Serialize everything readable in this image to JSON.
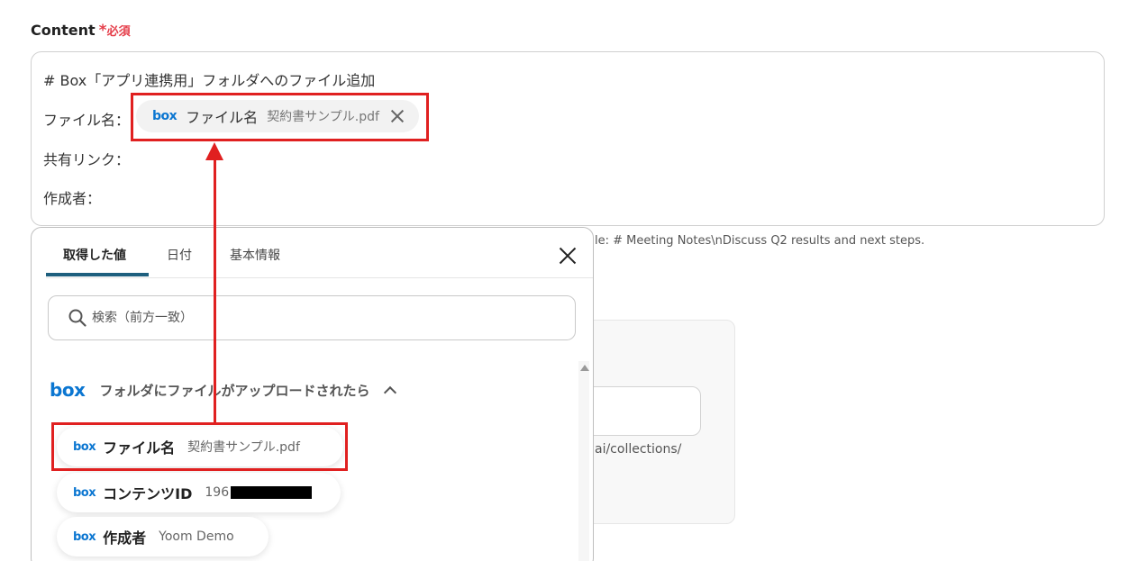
{
  "field": {
    "label": "Content",
    "required_star": "*",
    "required_text": "必須"
  },
  "editor": {
    "lines": [
      "# Box「アプリ連携用」フォルダへのファイル追加",
      "ファイル名：",
      "共有リンク：",
      "作成者："
    ],
    "chip": {
      "logo": "box",
      "name": "ファイル名",
      "value": "契約書サンプル.pdf"
    }
  },
  "background": {
    "hint": "le: # Meeting Notes\\nDiscuss Q2 results and next steps.",
    "url_fragment": "ai/collections/"
  },
  "popup": {
    "tabs": [
      {
        "label": "取得した値",
        "active": true
      },
      {
        "label": "日付",
        "active": false
      },
      {
        "label": "基本情報",
        "active": false
      }
    ],
    "search_placeholder": "検索（前方一致）",
    "group": {
      "logo": "box",
      "title": "フォルダにファイルがアップロードされたら"
    },
    "items": [
      {
        "logo": "box",
        "name": "ファイル名",
        "value": "契約書サンプル.pdf"
      },
      {
        "logo": "box",
        "name": "コンテンツID",
        "value": "196"
      },
      {
        "logo": "box",
        "name": "作成者",
        "value": "Yoom Demo"
      }
    ]
  },
  "colors": {
    "highlight": "#e02020",
    "box_brand": "#0b76d1",
    "required": "#e53e4a",
    "tab_active": "#1e5f7e"
  }
}
